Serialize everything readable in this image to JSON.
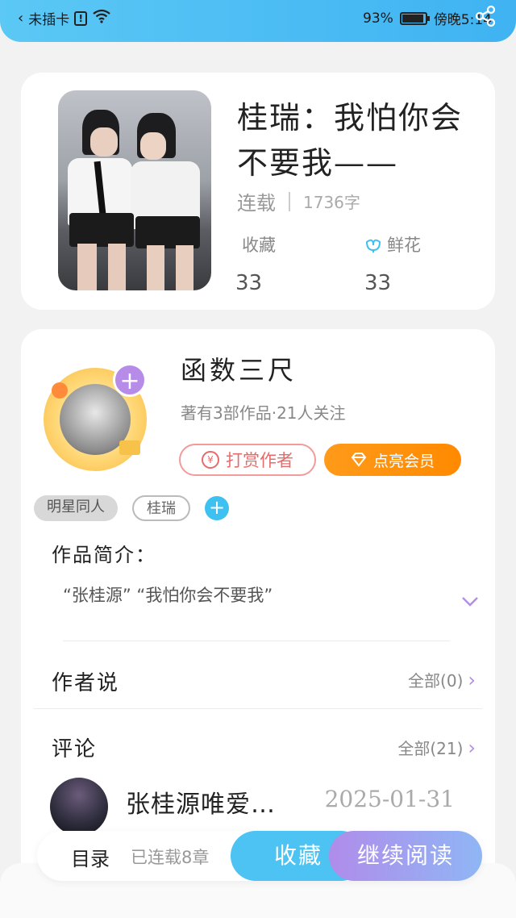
{
  "status_bar": {
    "carrier": "未插卡",
    "battery_percent": "93%",
    "battery_level": 0.93,
    "time": "傍晚5:14"
  },
  "book": {
    "title": "桂瑞：我怕你会不要我——",
    "status": "连载",
    "word_count": "1736字",
    "favorites_label": "收藏",
    "favorites_count": "33",
    "flowers_label": "鲜花",
    "flowers_count": "33"
  },
  "author": {
    "name": "函数三尺",
    "meta": "著有3部作品·21人关注",
    "reward_label": "打赏作者",
    "vip_label": "点亮会员"
  },
  "tags": [
    "明星同人",
    "桂瑞"
  ],
  "intro": {
    "title": "作品简介：",
    "text": "“张桂源” “我怕你会不要我”"
  },
  "author_says": {
    "title": "作者说",
    "more": "全部(0)"
  },
  "comments": {
    "title": "评论",
    "more": "全部(21)",
    "items": [
      {
        "user": "张桂源唯爱…",
        "date": "2025-01-31"
      }
    ]
  },
  "bottom_bar": {
    "toc": "目录",
    "chapters": "已连载8章",
    "favorite": "收藏",
    "continue": "继续阅读"
  },
  "colors": {
    "accent_blue": "#4cc3f2",
    "accent_purple": "#b08cea",
    "vip_orange": "#ff8a00",
    "reward_red": "#e86b6b"
  }
}
